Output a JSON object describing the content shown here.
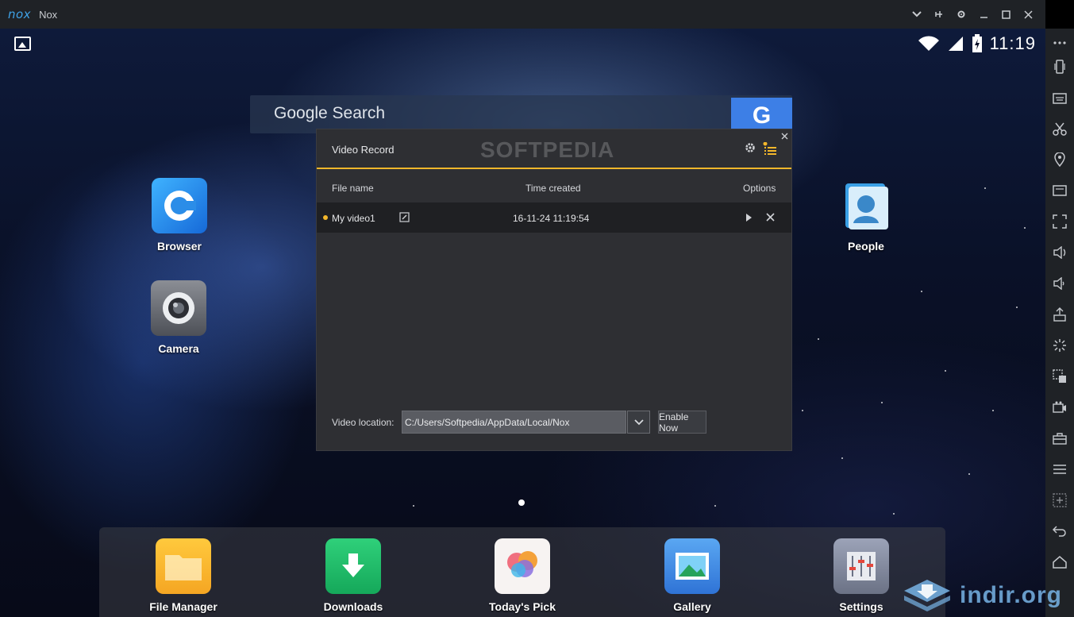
{
  "window": {
    "logo": "nox",
    "title": "Nox",
    "controls": [
      "chevron-down-icon",
      "pin-icon",
      "gear-icon",
      "minimize-icon",
      "maximize-icon",
      "close-icon"
    ]
  },
  "statusbar": {
    "time": "11:19"
  },
  "search": {
    "placeholder": "Google Search",
    "button": "G"
  },
  "desktop_apps": [
    {
      "label": "Browser"
    },
    {
      "label": "Camera"
    },
    {
      "label": "People"
    }
  ],
  "dock_apps": [
    {
      "label": "File Manager"
    },
    {
      "label": "Downloads"
    },
    {
      "label": "Today's Pick"
    },
    {
      "label": "Gallery"
    },
    {
      "label": "Settings"
    }
  ],
  "dialog": {
    "title": "Video Record",
    "watermark": "SOFTPEDIA",
    "columns": {
      "file_name": "File name",
      "time_created": "Time created",
      "options": "Options"
    },
    "rows": [
      {
        "file_name": "My video1",
        "time_created": "16-11-24 11:19:54"
      }
    ],
    "location_label": "Video location:",
    "location_value": "C:/Users/Softpedia/AppData/Local/Nox",
    "enable_button": "Enable Now"
  },
  "sidebar": {
    "icons": [
      "more-icon",
      "shake-icon",
      "keyboard-icon",
      "scissors-icon",
      "location-icon",
      "screen-icon",
      "fullscreen-icon",
      "volume-up-icon",
      "volume-down-icon",
      "apk-install-icon",
      "loading-icon",
      "multi-drive-icon",
      "video-record-icon",
      "toolbox-icon",
      "menu-icon",
      "add-icon",
      "back-icon",
      "home-icon"
    ]
  },
  "watermark_brand": {
    "text": "indir.org"
  }
}
